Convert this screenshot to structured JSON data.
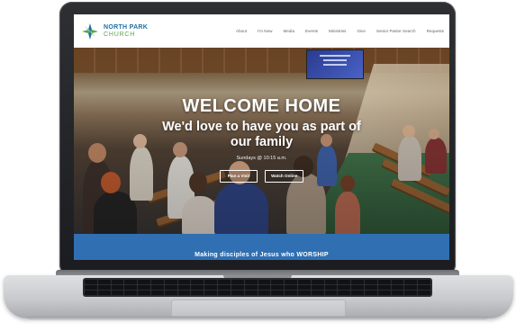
{
  "site": {
    "logo": {
      "line1": "NORTH PARK",
      "line2": "CHURCH"
    },
    "nav": [
      {
        "label": "About"
      },
      {
        "label": "I'm New"
      },
      {
        "label": "Media"
      },
      {
        "label": "Events"
      },
      {
        "label": "Ministries"
      },
      {
        "label": "Give"
      },
      {
        "label": "Senior Pastor Search"
      },
      {
        "label": "Requests"
      }
    ]
  },
  "hero": {
    "title": "WELCOME HOME",
    "subtitle": "We'd love to have you as part of our family",
    "service_time": "Sundays @ 10:15 a.m.",
    "plan_visit_label": "Plan a Visit",
    "watch_online_label": "Watch Online"
  },
  "band": {
    "text": "Making disciples of Jesus who WORSHIP"
  },
  "colors": {
    "brand_blue": "#1f6fa3",
    "brand_green": "#5aa84a",
    "band_blue": "#2f6fb2"
  }
}
